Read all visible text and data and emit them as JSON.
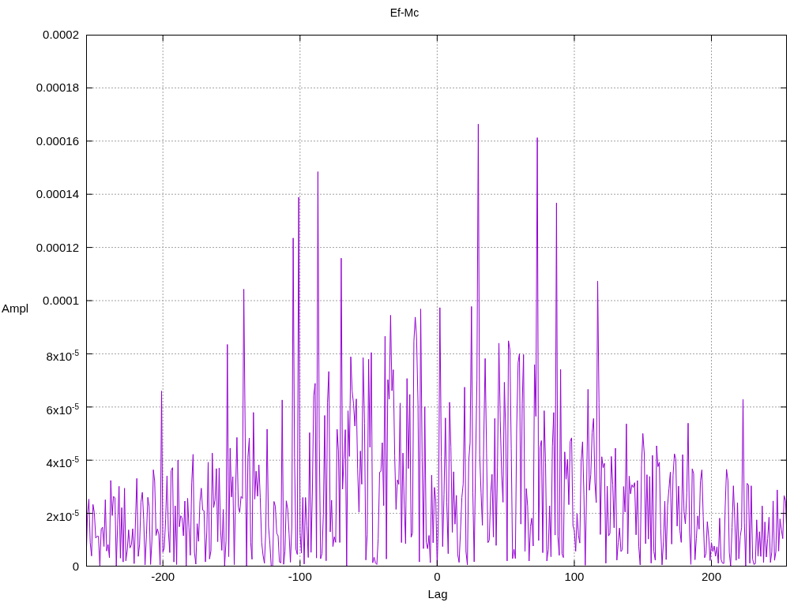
{
  "title": "Ef-Mc",
  "ylabel": "Ampl",
  "xlabel": "Lag",
  "yticks": [
    "0.0002",
    "0.00018",
    "0.00016",
    "0.00014",
    "0.00012",
    "0.0001",
    "8x10$^{-5}$",
    "6x10$^{-5}$",
    "4x10$^{-5}$",
    "2x10$^{-5}$",
    "0"
  ],
  "xticks": [
    "-200",
    "-100",
    "0",
    "100",
    "200"
  ]
}
